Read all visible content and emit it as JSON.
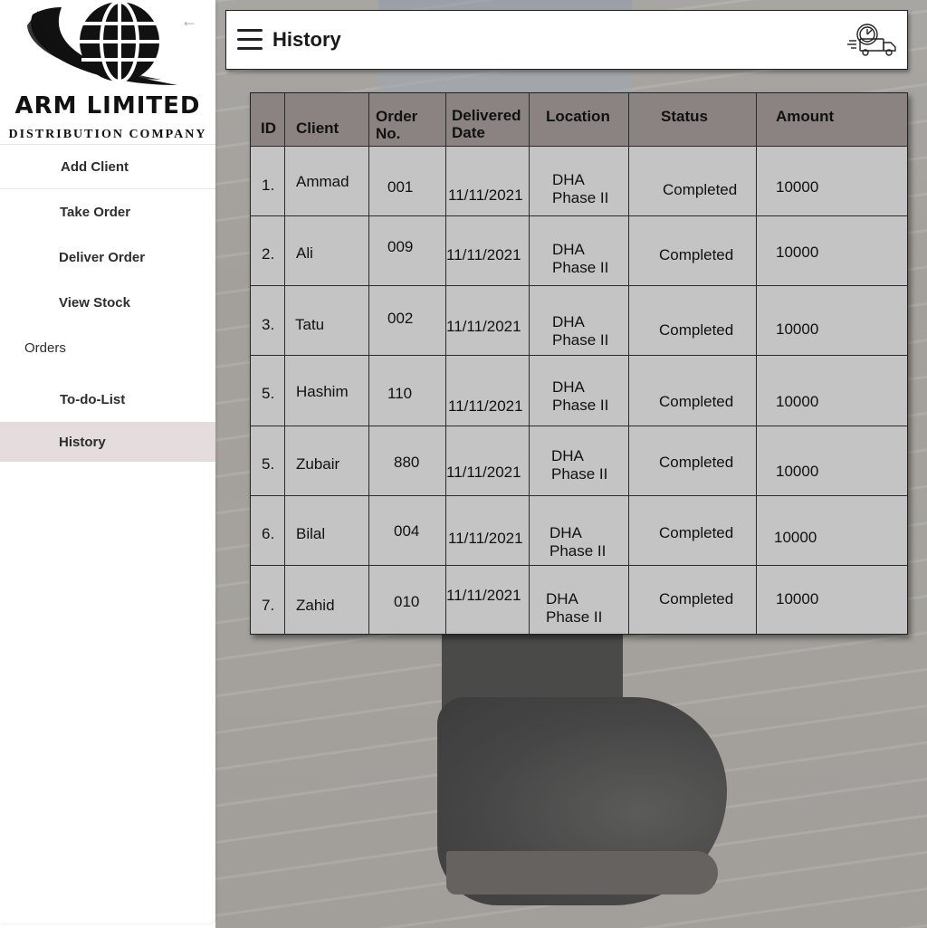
{
  "sidebar": {
    "brand": {
      "name": "ARM LIMITED",
      "subtitle": "DISTRIBUTION COMPANY"
    },
    "collapse_icon": "arrow-left-icon",
    "items": [
      {
        "label": "Add Client"
      },
      {
        "label": "Take Order"
      },
      {
        "label": "Deliver Order"
      },
      {
        "label": "View Stock"
      }
    ],
    "section": "Orders",
    "sub_items": [
      {
        "label": "To-do-List"
      },
      {
        "label": "History",
        "active": true
      }
    ],
    "active_color": "#e4dcdd"
  },
  "header": {
    "title": "History",
    "menu_icon": "hamburger-menu-icon",
    "right_icon": "delivery-truck-icon"
  },
  "table": {
    "header_color": "#8b8381",
    "body_color": "#c4c4c4",
    "columns": [
      "ID",
      "Client",
      "Order No.",
      "Delivered Date",
      "Location",
      "Status",
      "Amount"
    ],
    "column_lines": {
      "order_no": [
        "Order",
        "No."
      ],
      "delivered_date": [
        "Delivered",
        "Date"
      ]
    },
    "rows": [
      {
        "id": "1.",
        "client": "Ammad",
        "order_no": "001",
        "date": "11/11/2021",
        "location_l1": "DHA",
        "location_l2": "Phase II",
        "status": "Completed",
        "amount": "10000"
      },
      {
        "id": "2.",
        "client": "Ali",
        "order_no": "009",
        "date": "11/11/2021",
        "location_l1": "DHA",
        "location_l2": "Phase II",
        "status": "Completed",
        "amount": "10000"
      },
      {
        "id": "3.",
        "client": "Tatu",
        "order_no": "002",
        "date": "11/11/2021",
        "location_l1": "DHA",
        "location_l2": "Phase II",
        "status": "Completed",
        "amount": "10000"
      },
      {
        "id": "5.",
        "client": "Hashim",
        "order_no": "110",
        "date": "11/11/2021",
        "location_l1": "DHA",
        "location_l2": "Phase II",
        "status": "Completed",
        "amount": "10000"
      },
      {
        "id": "5.",
        "client": "Zubair",
        "order_no": "880",
        "date": "11/11/2021",
        "location_l1": "DHA",
        "location_l2": "Phase II",
        "status": "Completed",
        "amount": "10000"
      },
      {
        "id": "6.",
        "client": "Bilal",
        "order_no": "004",
        "date": "11/11/2021",
        "location_l1": "DHA",
        "location_l2": "Phase II",
        "status": "Completed",
        "amount": "10000"
      },
      {
        "id": "7.",
        "client": "Zahid",
        "order_no": "010",
        "date": "11/11/2021",
        "location_l1": "DHA",
        "location_l2": "Phase II",
        "status": "Completed",
        "amount": "10000"
      }
    ]
  }
}
